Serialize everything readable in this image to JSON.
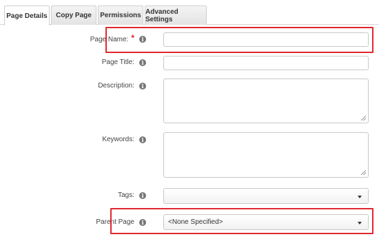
{
  "tabs": [
    {
      "label": "Page Details"
    },
    {
      "label": "Copy Page"
    },
    {
      "label": "Permissions"
    },
    {
      "label": "Advanced Settings"
    }
  ],
  "form": {
    "page_name": {
      "label": "Page Name:",
      "required_marker": "*",
      "value": ""
    },
    "page_title": {
      "label": "Page Title:",
      "value": ""
    },
    "description": {
      "label": "Description:",
      "value": ""
    },
    "keywords": {
      "label": "Keywords:",
      "value": ""
    },
    "tags": {
      "label": "Tags:",
      "value": ""
    },
    "parent_page": {
      "label": "Parent Page",
      "value": "<None Specified>"
    }
  },
  "icons": {
    "info": "info-icon",
    "caret": "caret-down-icon"
  },
  "colors": {
    "highlight": "#e1262d",
    "required": "#dd2222"
  }
}
